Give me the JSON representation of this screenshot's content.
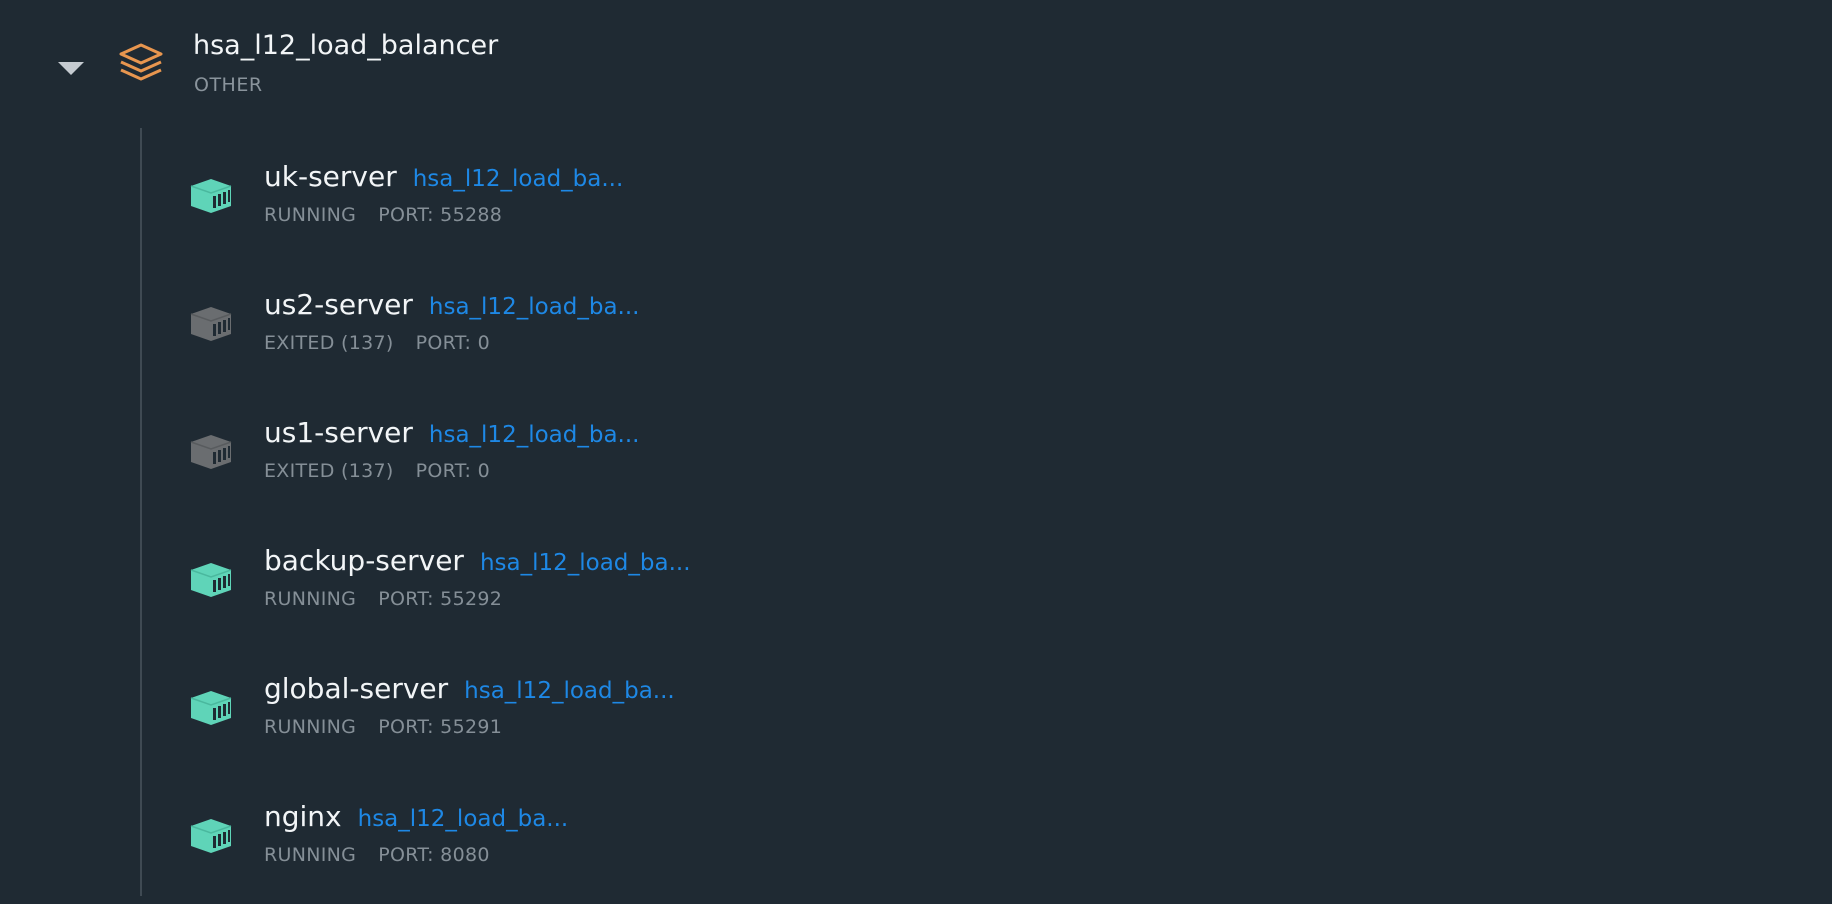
{
  "group": {
    "title": "hsa_l12_load_balancer",
    "type": "OTHER",
    "icon": "stack-layers-icon",
    "expand_icon": "caret-down-icon",
    "accent_color": "#e8964f"
  },
  "colors": {
    "running": "#5fd4b8",
    "exited": "#6a6d70",
    "project_link": "#1e88e5"
  },
  "containers": [
    {
      "name": "uk-server",
      "project": "hsa_l12_load_ba...",
      "status": "RUNNING",
      "port": "PORT: 55288",
      "state": "running"
    },
    {
      "name": "us2-server",
      "project": "hsa_l12_load_ba...",
      "status": "EXITED (137)",
      "port": "PORT: 0",
      "state": "exited"
    },
    {
      "name": "us1-server",
      "project": "hsa_l12_load_ba...",
      "status": "EXITED (137)",
      "port": "PORT: 0",
      "state": "exited"
    },
    {
      "name": "backup-server",
      "project": "hsa_l12_load_ba...",
      "status": "RUNNING",
      "port": "PORT: 55292",
      "state": "running"
    },
    {
      "name": "global-server",
      "project": "hsa_l12_load_ba...",
      "status": "RUNNING",
      "port": "PORT: 55291",
      "state": "running"
    },
    {
      "name": "nginx",
      "project": "hsa_l12_load_ba...",
      "status": "RUNNING",
      "port": "PORT: 8080",
      "state": "running"
    }
  ]
}
